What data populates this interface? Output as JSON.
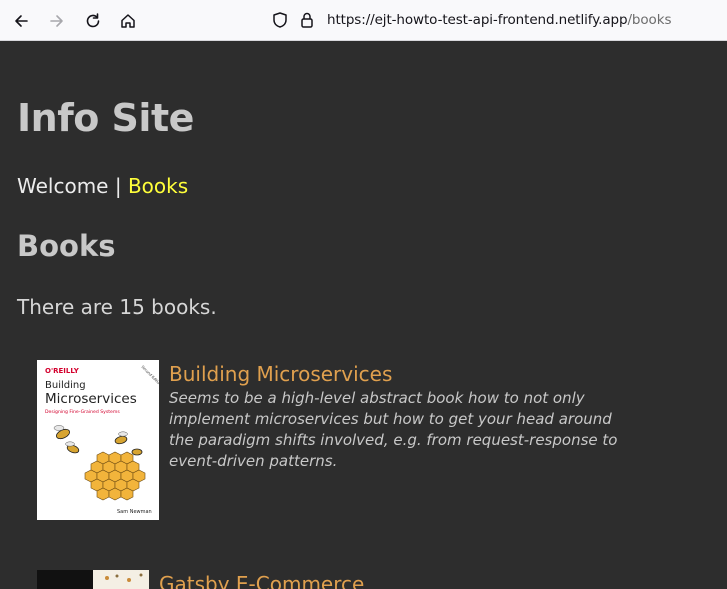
{
  "browser": {
    "url_host": "https://ejt-howto-test-api-frontend.netlify.app",
    "url_path": "/books"
  },
  "site": {
    "title": "Info Site",
    "nav": {
      "welcome": "Welcome",
      "separator": "|",
      "books": "Books"
    }
  },
  "books_section": {
    "heading": "Books",
    "count_text": "There are 15 books."
  },
  "books": [
    {
      "title": "Building Microservices",
      "description": "Seems to be a high-level abstract book how to not only implement microservices but how to get your head around the paradigm shifts involved, e.g. from request-response to event-driven patterns.",
      "cover": {
        "publisher": "O'REILLY",
        "title_line1": "Building",
        "title_line2": "Microservices",
        "subtitle": "Designing Fine-Grained Systems",
        "edition": "Second Edition",
        "author": "Sam Newman"
      }
    },
    {
      "title": "Gatsby E-Commerce"
    }
  ],
  "colors": {
    "background": "#2d2d2d",
    "link": "#ffff3a",
    "book_title": "#e0a04e"
  }
}
